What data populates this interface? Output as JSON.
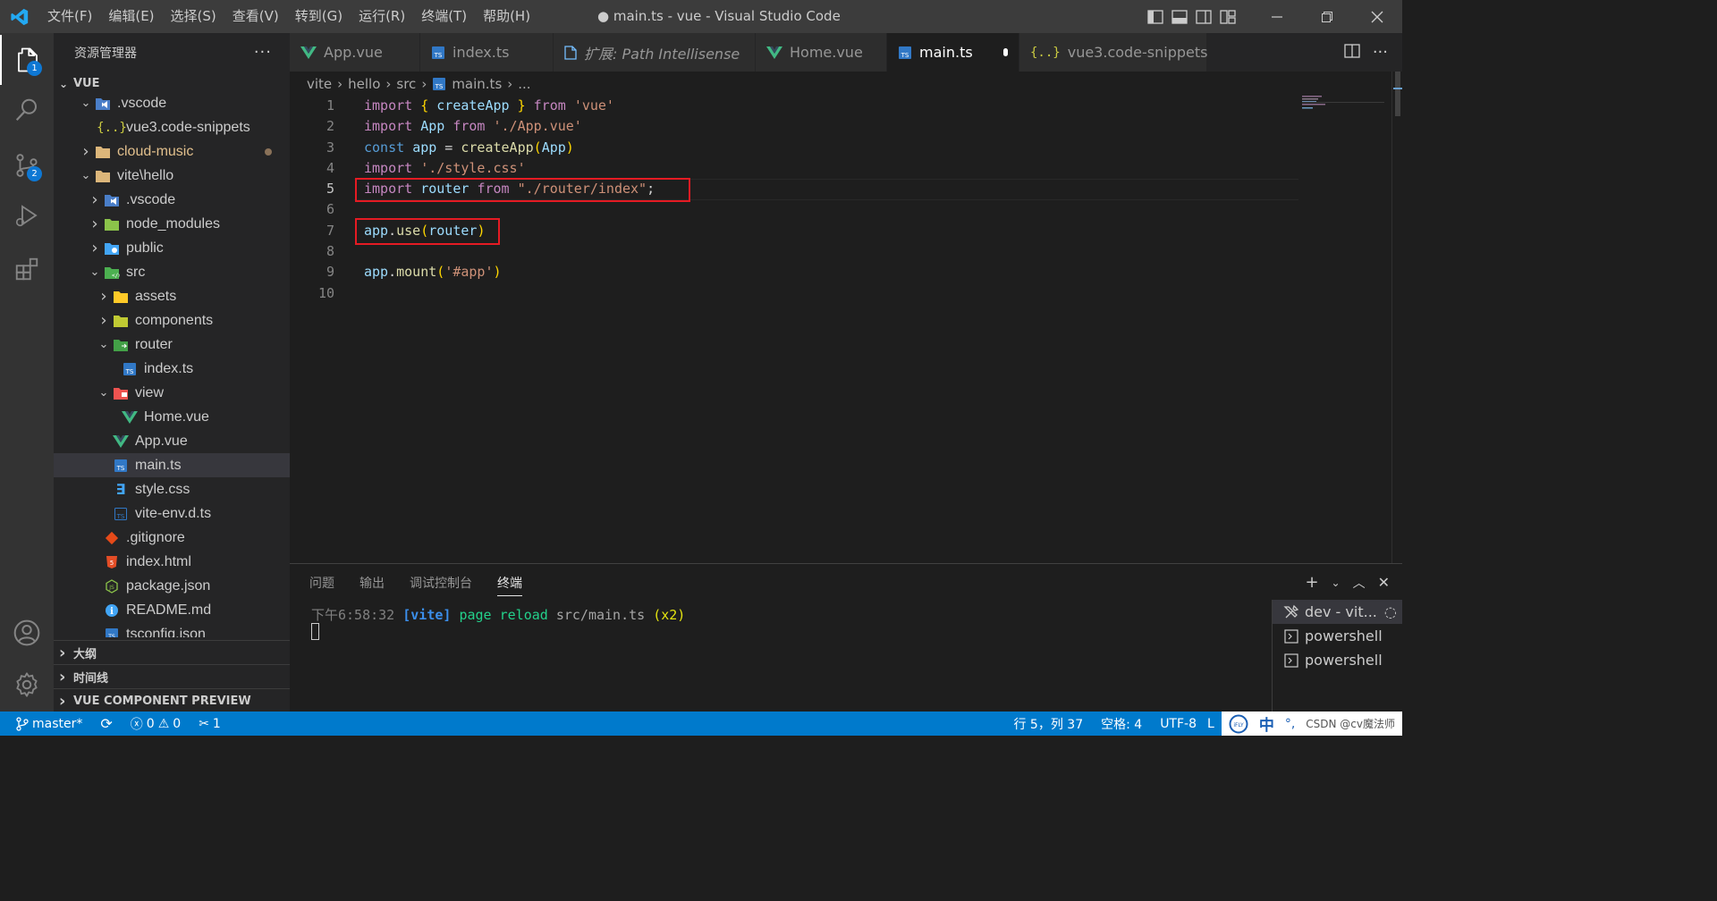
{
  "window": {
    "title": "● main.ts - vue - Visual Studio Code",
    "menu": [
      "文件(F)",
      "编辑(E)",
      "选择(S)",
      "查看(V)",
      "转到(G)",
      "运行(R)",
      "终端(T)",
      "帮助(H)"
    ],
    "controls": [
      "minimize",
      "restore",
      "close"
    ]
  },
  "activity_bar": {
    "items": [
      {
        "name": "explorer",
        "icon": "files-icon",
        "badge": "1"
      },
      {
        "name": "search",
        "icon": "search-icon",
        "badge": ""
      },
      {
        "name": "source-control",
        "icon": "source-control-icon",
        "badge": "2"
      },
      {
        "name": "run-and-debug",
        "icon": "run-debug-icon",
        "badge": ""
      },
      {
        "name": "extensions",
        "icon": "extensions-icon",
        "badge": ""
      }
    ],
    "bottom": [
      "accounts-icon",
      "manage-gear-icon"
    ]
  },
  "sidebar": {
    "title": "资源管理器",
    "root": "VUE",
    "tree": [
      {
        "label": ".vscode",
        "depth": 1,
        "kind": "folder-vscode",
        "open": true
      },
      {
        "label": "vue3.code-snippets",
        "depth": 2,
        "kind": "json"
      },
      {
        "label": "cloud-music",
        "depth": 1,
        "kind": "folder",
        "open": false,
        "modified": true,
        "color": "#e2c08d"
      },
      {
        "label": "vite\\hello",
        "depth": 1,
        "kind": "folder",
        "open": true
      },
      {
        "label": ".vscode",
        "depth": 2,
        "kind": "folder-vscode",
        "open": false
      },
      {
        "label": "node_modules",
        "depth": 2,
        "kind": "folder-node",
        "open": false
      },
      {
        "label": "public",
        "depth": 2,
        "kind": "folder-public",
        "open": false
      },
      {
        "label": "src",
        "depth": 2,
        "kind": "folder-src",
        "open": true
      },
      {
        "label": "assets",
        "depth": 3,
        "kind": "folder-assets",
        "open": false
      },
      {
        "label": "components",
        "depth": 3,
        "kind": "folder-components",
        "open": false
      },
      {
        "label": "router",
        "depth": 3,
        "kind": "folder-router",
        "open": true
      },
      {
        "label": "index.ts",
        "depth": 4,
        "kind": "ts"
      },
      {
        "label": "view",
        "depth": 3,
        "kind": "folder-view",
        "open": true
      },
      {
        "label": "Home.vue",
        "depth": 4,
        "kind": "vue"
      },
      {
        "label": "App.vue",
        "depth": 3,
        "kind": "vue"
      },
      {
        "label": "main.ts",
        "depth": 3,
        "kind": "ts",
        "selected": true
      },
      {
        "label": "style.css",
        "depth": 3,
        "kind": "css"
      },
      {
        "label": "vite-env.d.ts",
        "depth": 3,
        "kind": "dts"
      },
      {
        "label": ".gitignore",
        "depth": 2,
        "kind": "git"
      },
      {
        "label": "index.html",
        "depth": 2,
        "kind": "html"
      },
      {
        "label": "package.json",
        "depth": 2,
        "kind": "npm"
      },
      {
        "label": "README.md",
        "depth": 2,
        "kind": "info"
      },
      {
        "label": "tsconfig.json",
        "depth": 2,
        "kind": "tsconfig"
      }
    ],
    "sections": [
      "大纲",
      "时间线",
      "VUE COMPONENT PREVIEW"
    ]
  },
  "tabs": [
    {
      "label": "App.vue",
      "icon": "vue",
      "active": false,
      "italic": false
    },
    {
      "label": "index.ts",
      "icon": "ts",
      "active": false,
      "italic": false
    },
    {
      "label": "扩展: Path Intellisense",
      "icon": "doc",
      "active": false,
      "italic": true
    },
    {
      "label": "Home.vue",
      "icon": "vue",
      "active": false,
      "italic": false
    },
    {
      "label": "main.ts",
      "icon": "ts",
      "active": true,
      "italic": false,
      "dirty": true
    },
    {
      "label": "vue3.code-snippets",
      "icon": "json",
      "active": false,
      "italic": false
    }
  ],
  "breadcrumb": [
    "vite",
    "hello",
    "src",
    "main.ts",
    "..."
  ],
  "editor": {
    "active_line": 5,
    "lines": [
      [
        [
          "kw",
          "import"
        ],
        [
          "p",
          " "
        ],
        [
          "br",
          "{"
        ],
        [
          "p",
          " "
        ],
        [
          "var",
          "createApp"
        ],
        [
          "p",
          " "
        ],
        [
          "br",
          "}"
        ],
        [
          "p",
          " "
        ],
        [
          "kw",
          "from"
        ],
        [
          "p",
          " "
        ],
        [
          "str",
          "'vue'"
        ]
      ],
      [
        [
          "kw",
          "import"
        ],
        [
          "p",
          " "
        ],
        [
          "var",
          "App"
        ],
        [
          "p",
          " "
        ],
        [
          "kw",
          "from"
        ],
        [
          "p",
          " "
        ],
        [
          "str",
          "'./App.vue'"
        ]
      ],
      [
        [
          "kwb",
          "const"
        ],
        [
          "p",
          " "
        ],
        [
          "var",
          "app"
        ],
        [
          "p",
          " = "
        ],
        [
          "fn",
          "createApp"
        ],
        [
          "br",
          "("
        ],
        [
          "var",
          "App"
        ],
        [
          "br",
          ")"
        ]
      ],
      [
        [
          "kw",
          "import"
        ],
        [
          "p",
          " "
        ],
        [
          "str",
          "'./style.css'"
        ]
      ],
      [
        [
          "kw",
          "import"
        ],
        [
          "p",
          " "
        ],
        [
          "var",
          "router"
        ],
        [
          "p",
          " "
        ],
        [
          "kw",
          "from"
        ],
        [
          "p",
          " "
        ],
        [
          "str",
          "\"./router/index\""
        ],
        [
          "p",
          ";"
        ]
      ],
      [],
      [
        [
          "var",
          "app"
        ],
        [
          "p",
          "."
        ],
        [
          "fn",
          "use"
        ],
        [
          "br",
          "("
        ],
        [
          "var",
          "router"
        ],
        [
          "br",
          ")"
        ]
      ],
      [],
      [
        [
          "var",
          "app"
        ],
        [
          "p",
          "."
        ],
        [
          "fn",
          "mount"
        ],
        [
          "br",
          "("
        ],
        [
          "str",
          "'#app'"
        ],
        [
          "br",
          ")"
        ]
      ],
      []
    ]
  },
  "panel": {
    "tabs": [
      "问题",
      "输出",
      "调试控制台",
      "终端"
    ],
    "active_tab": "终端",
    "terminal_line": {
      "time": "下午6:58:32",
      "tag": "[vite]",
      "msg": "page reload",
      "path": "src/main.ts",
      "count": "(x2)"
    },
    "terminals": [
      {
        "label": "dev - vit...",
        "icon": "tools-icon",
        "active": true
      },
      {
        "label": "powershell",
        "icon": "terminal-icon",
        "active": false
      },
      {
        "label": "powershell",
        "icon": "terminal-icon",
        "active": false
      }
    ]
  },
  "statusbar": {
    "branch": "master*",
    "errors": "0",
    "warnings": "0",
    "ports": "1",
    "position": "行 5，列 37",
    "spaces": "空格: 4",
    "encoding": "UTF-8",
    "eol_partial": "L",
    "ime_label": "中",
    "watermark": "CSDN @cv魔法师"
  }
}
